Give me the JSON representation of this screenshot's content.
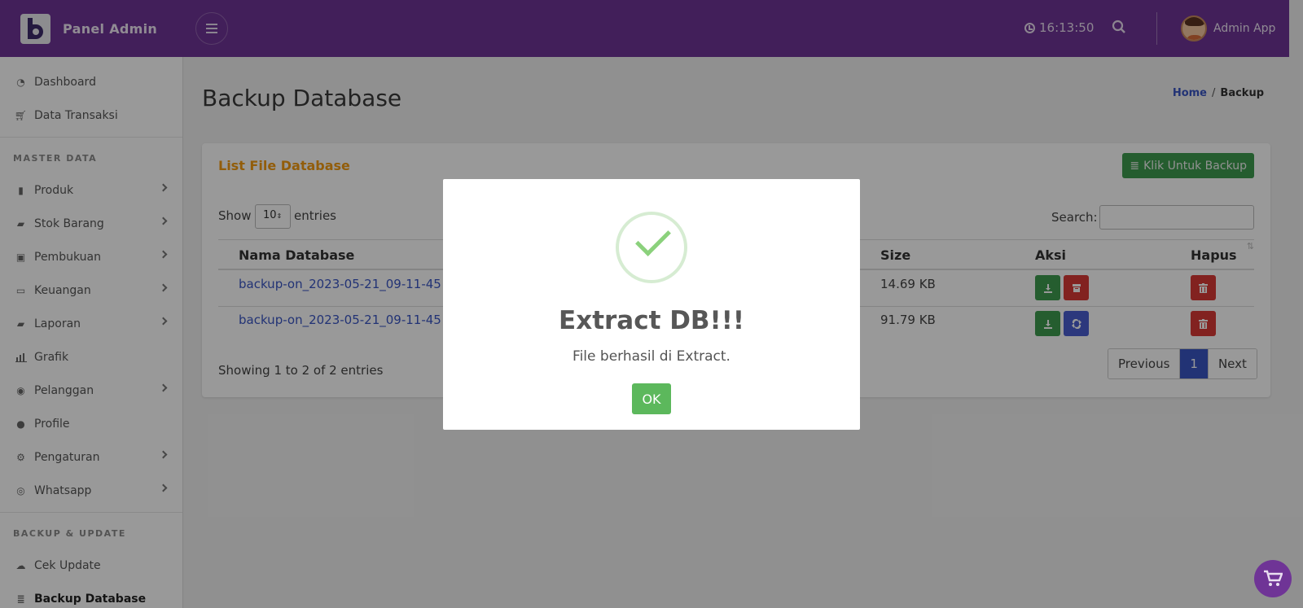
{
  "header": {
    "brand_title": "Panel Admin",
    "clock": "16:13:50",
    "user_name": "Admin App"
  },
  "sidebar": {
    "items_top": [
      {
        "label": "Dashboard",
        "icon": "dashboard-icon"
      },
      {
        "label": "Data Transaksi",
        "icon": "cart-icon"
      }
    ],
    "master_heading": "MASTER DATA",
    "master_items": [
      {
        "label": "Produk",
        "icon": "file-icon"
      },
      {
        "label": "Stok Barang",
        "icon": "book-icon"
      },
      {
        "label": "Pembukuan",
        "icon": "ledger-icon"
      },
      {
        "label": "Keuangan",
        "icon": "credit-card-icon"
      },
      {
        "label": "Laporan",
        "icon": "book-icon"
      },
      {
        "label": "Grafik",
        "icon": "bar-chart-icon"
      },
      {
        "label": "Pelanggan",
        "icon": "user-circle-icon"
      },
      {
        "label": "Profile",
        "icon": "user-icon"
      },
      {
        "label": "Pengaturan",
        "icon": "gear-icon"
      },
      {
        "label": "Whatsapp",
        "icon": "whatsapp-icon"
      }
    ],
    "backup_heading": "BACKUP & UPDATE",
    "backup_items": [
      {
        "label": "Cek Update",
        "icon": "cloud-download-icon"
      },
      {
        "label": "Backup Database",
        "icon": "database-icon"
      }
    ]
  },
  "main": {
    "page_title": "Backup Database",
    "breadcrumb_home": "Home",
    "breadcrumb_sep": "/",
    "breadcrumb_current": "Backup"
  },
  "card": {
    "title": "List File Database",
    "backup_button": "Klik Untuk Backup",
    "show_label": "Show",
    "entries_value": "10",
    "entries_label": "entries",
    "search_label": "Search:",
    "columns": {
      "name": "Nama Database",
      "size": "Size",
      "action": "Aksi",
      "delete": "Hapus"
    },
    "rows": [
      {
        "name": "backup-on_2023-05-21_09-11-45",
        "size": "14.69 KB"
      },
      {
        "name": "backup-on_2023-05-21_09-11-45",
        "size": "91.79 KB"
      }
    ],
    "info": "Showing 1 to 2 of 2 entries",
    "pager": {
      "previous": "Previous",
      "current": "1",
      "next": "Next"
    }
  },
  "modal": {
    "title": "Extract DB!!!",
    "text": "File berhasil di Extract.",
    "ok": "OK"
  },
  "colors": {
    "brand": "#6f3496",
    "accent_orange": "#f39c12",
    "success": "#5cb85c",
    "link": "#3a55c4"
  }
}
